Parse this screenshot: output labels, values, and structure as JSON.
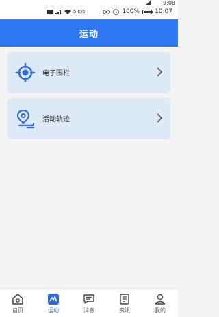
{
  "status": {
    "top_time": "9:08",
    "speed": "5 K/s",
    "battery": "100%",
    "time": "10:07"
  },
  "header": {
    "title": "运动"
  },
  "cards": [
    {
      "label": "电子围栏",
      "icon": "target-icon"
    },
    {
      "label": "活动轨迹",
      "icon": "location-track-icon"
    }
  ],
  "tabs": [
    {
      "label": "首页",
      "icon": "home-icon",
      "active": false
    },
    {
      "label": "运动",
      "icon": "activity-icon",
      "active": true
    },
    {
      "label": "消息",
      "icon": "message-icon",
      "active": false
    },
    {
      "label": "资讯",
      "icon": "news-icon",
      "active": false
    },
    {
      "label": "我的",
      "icon": "profile-icon",
      "active": false
    }
  ],
  "colors": {
    "primary": "#3078f2",
    "card_bg": "#dde9f7",
    "active_tab": "#2f6ad8"
  }
}
